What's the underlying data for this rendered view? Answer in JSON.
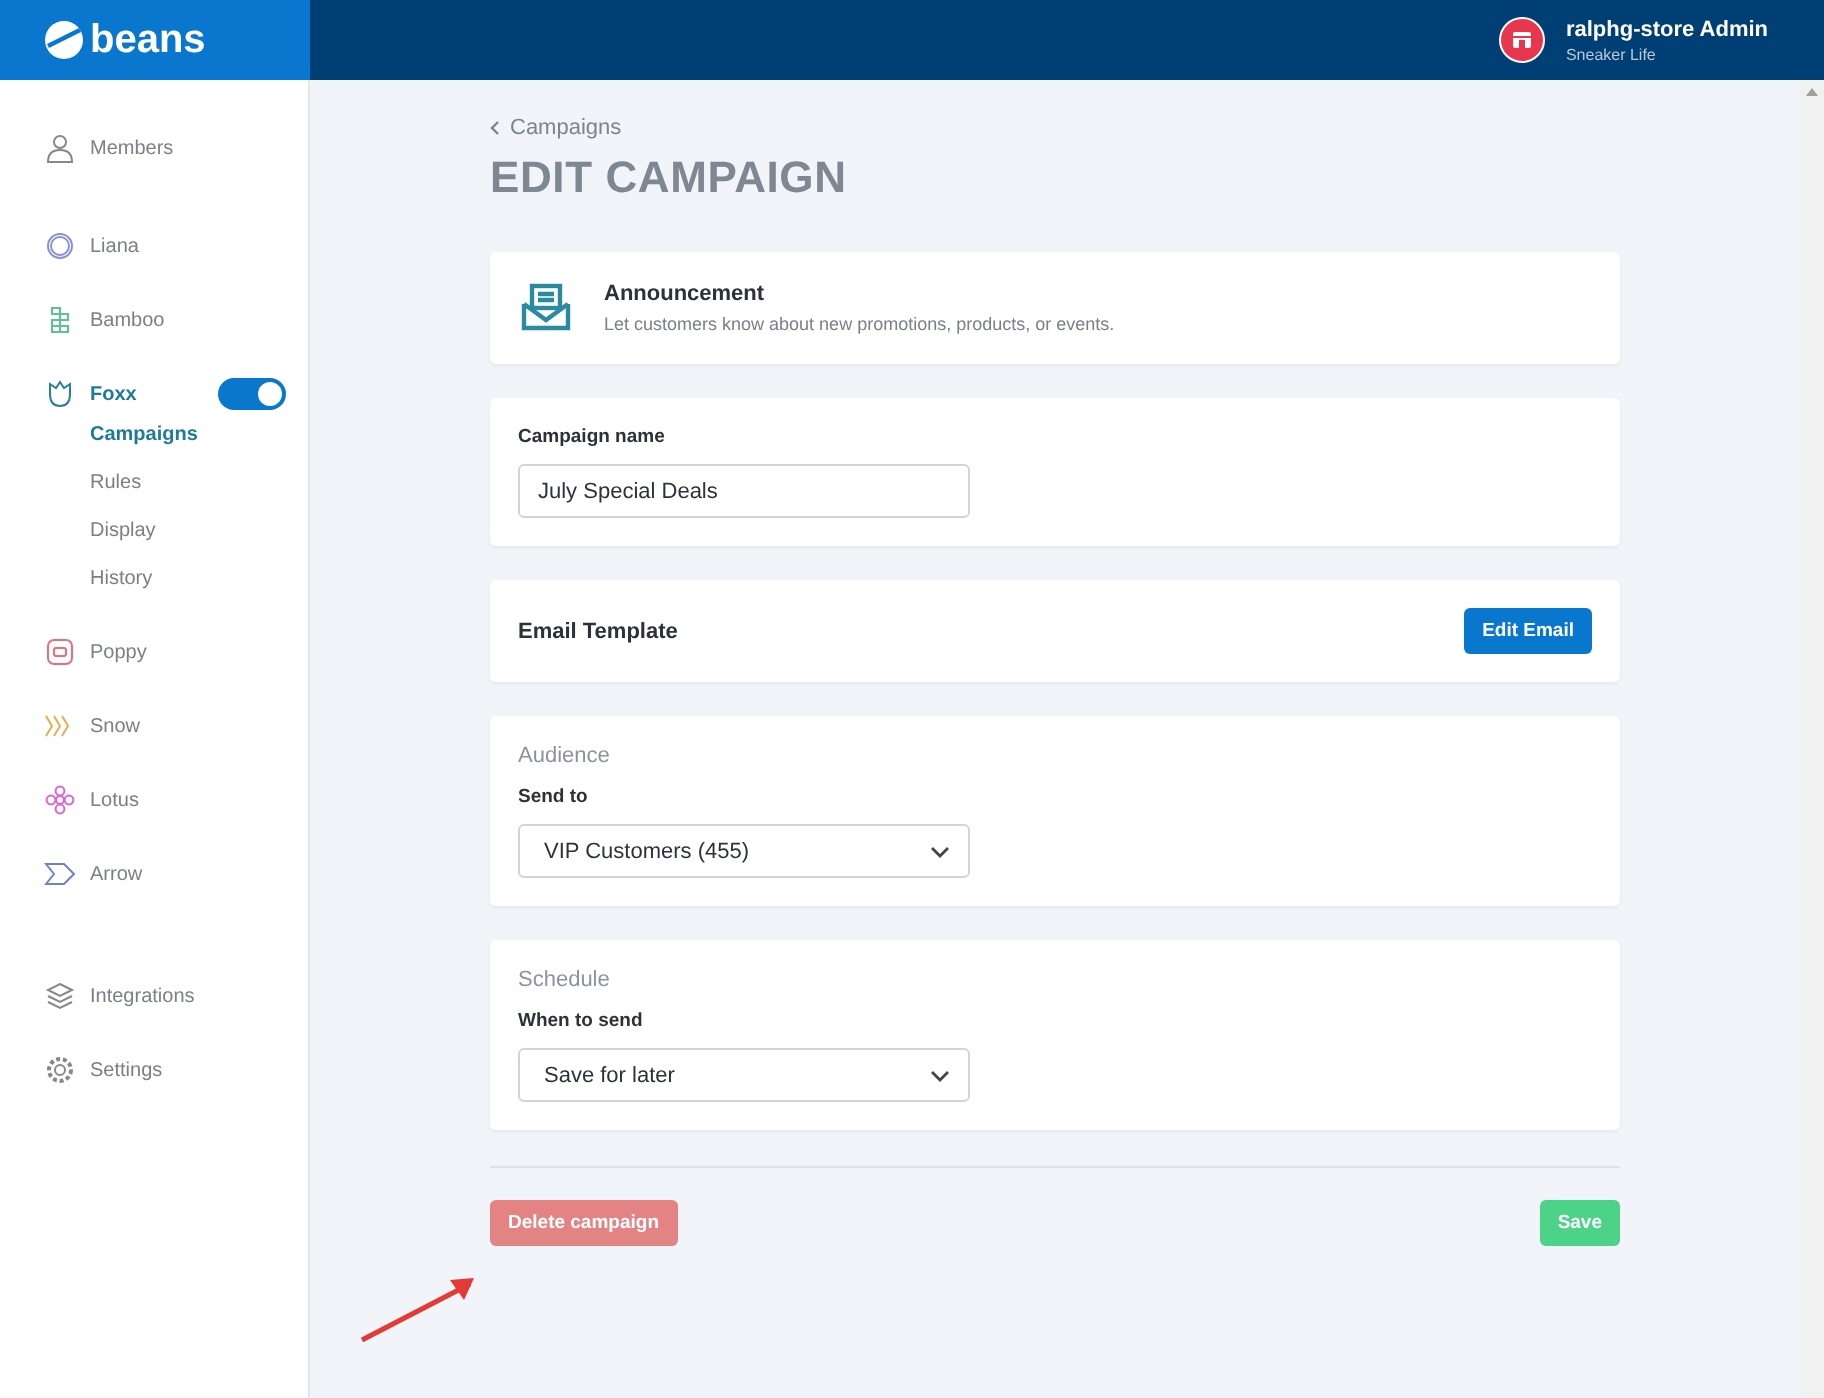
{
  "header": {
    "logo": "beans",
    "store_name": "ralphg-store Admin",
    "store_subtitle": "Sneaker Life"
  },
  "sidebar": {
    "groups": [
      {
        "items": [
          {
            "label": "Members",
            "selected": false
          }
        ]
      },
      {
        "items": [
          {
            "label": "Liana",
            "selected": false
          },
          {
            "label": "Bamboo",
            "selected": false
          },
          {
            "label": "Foxx",
            "selected": true,
            "toggle_on": true,
            "children": [
              {
                "label": "Campaigns",
                "selected": true
              },
              {
                "label": "Rules",
                "selected": false
              },
              {
                "label": "Display",
                "selected": false
              },
              {
                "label": "History",
                "selected": false
              }
            ]
          },
          {
            "label": "Poppy",
            "selected": false
          },
          {
            "label": "Snow",
            "selected": false
          },
          {
            "label": "Lotus",
            "selected": false
          },
          {
            "label": "Arrow",
            "selected": false
          }
        ]
      },
      {
        "items": [
          {
            "label": "Integrations",
            "selected": false
          },
          {
            "label": "Settings",
            "selected": false
          }
        ]
      }
    ]
  },
  "main": {
    "back_link": "Campaigns",
    "title": "EDIT CAMPAIGN",
    "type_card": {
      "title": "Announcement",
      "description": "Let customers know about new promotions, products, or events."
    },
    "name_card": {
      "label": "Campaign name",
      "value": "July Special Deals"
    },
    "email_card": {
      "title": "Email Template",
      "button": "Edit Email"
    },
    "audience_card": {
      "heading": "Audience",
      "label": "Send to",
      "value": "VIP Customers (455)"
    },
    "schedule_card": {
      "heading": "Schedule",
      "label": "When to send",
      "value": "Save for later"
    },
    "delete_button": "Delete campaign",
    "save_button": "Save"
  }
}
